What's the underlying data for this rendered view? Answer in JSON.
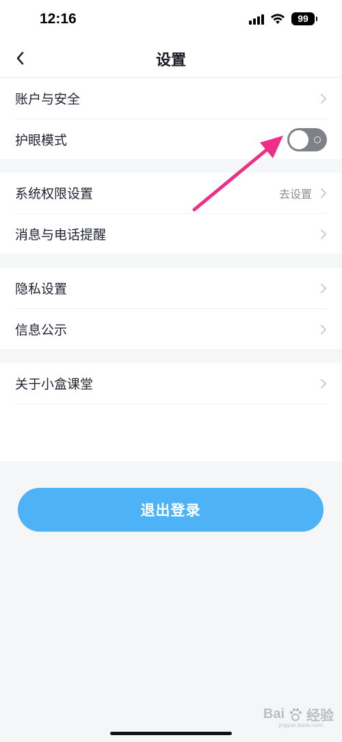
{
  "status_bar": {
    "time": "12:16",
    "battery": "99",
    "icons": [
      "signal-icon",
      "wifi-icon",
      "battery-icon"
    ]
  },
  "nav": {
    "title": "设置",
    "back_icon": "chevron-left-icon"
  },
  "groups": [
    {
      "items": [
        {
          "label": "账户与安全",
          "type": "link"
        },
        {
          "label": "护眼模式",
          "type": "toggle",
          "toggle_on": false
        }
      ]
    },
    {
      "items": [
        {
          "label": "系统权限设置",
          "value": "去设置",
          "type": "link"
        },
        {
          "label": "消息与电话提醒",
          "type": "link"
        }
      ]
    },
    {
      "items": [
        {
          "label": "隐私设置",
          "type": "link"
        },
        {
          "label": "信息公示",
          "type": "link"
        }
      ]
    },
    {
      "items": [
        {
          "label": "关于小盒课堂",
          "type": "link"
        }
      ]
    }
  ],
  "logout": {
    "label": "退出登录"
  },
  "watermark": {
    "brand": "Bai",
    "brand_suffix": "经验",
    "sub": "jingyan.baidu.com"
  },
  "colors": {
    "accent": "#4db3f6",
    "arrow": "#ee2f86",
    "toggle_off": "#7f8188",
    "background": "#f5f6f8"
  }
}
